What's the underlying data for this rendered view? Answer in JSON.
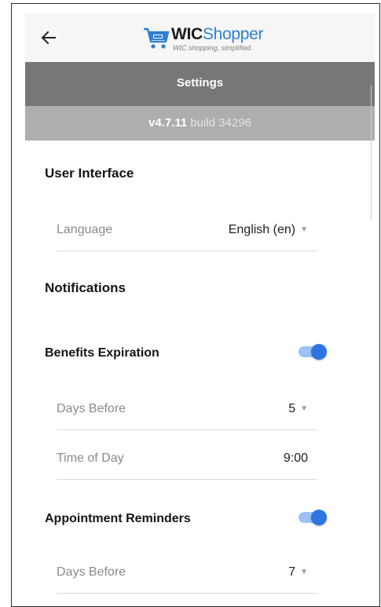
{
  "header": {
    "back_icon": "arrow-left-icon",
    "logo": {
      "wic": "WIC",
      "shopper": "Shopper",
      "tagline": "WIC shopping, simplified."
    }
  },
  "title_bar": {
    "title": "Settings"
  },
  "version_bar": {
    "version": "v4.7.11",
    "build": "build 34296"
  },
  "user_interface": {
    "title": "User Interface",
    "language": {
      "label": "Language",
      "value": "English (en)"
    }
  },
  "notifications": {
    "title": "Notifications",
    "benefits_expiration": {
      "label": "Benefits Expiration",
      "enabled": true,
      "days_before": {
        "label": "Days Before",
        "value": "5"
      },
      "time_of_day": {
        "label": "Time of Day",
        "value": "9:00"
      }
    },
    "appointment_reminders": {
      "label": "Appointment Reminders",
      "enabled": true,
      "days_before": {
        "label": "Days Before",
        "value": "7"
      }
    }
  },
  "colors": {
    "brand_blue": "#2f7fd1",
    "toggle_on": "#2d74e0",
    "title_band": "#777777",
    "version_band": "#aeaeae"
  }
}
